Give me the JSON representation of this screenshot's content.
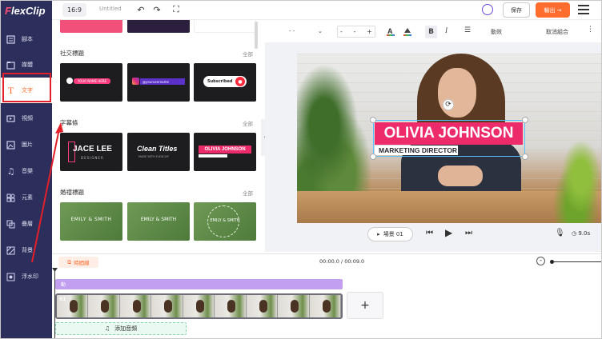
{
  "app": {
    "logo": "FlexClip",
    "ratio": "16:9",
    "project_title": "Untitled",
    "save_label": "保存",
    "export_label": "輸出 →"
  },
  "sidebar": {
    "items": [
      {
        "label": "腳本",
        "icon": "script-icon"
      },
      {
        "label": "媒體",
        "icon": "media-icon"
      },
      {
        "label": "文字",
        "icon": "text-icon",
        "active": true
      },
      {
        "label": "視頻",
        "icon": "video-icon"
      },
      {
        "label": "圖片",
        "icon": "image-icon"
      },
      {
        "label": "音樂",
        "icon": "music-icon"
      },
      {
        "label": "元素",
        "icon": "elements-icon"
      },
      {
        "label": "疊層",
        "icon": "overlay-icon"
      },
      {
        "label": "背景",
        "icon": "background-icon"
      },
      {
        "label": "浮水印",
        "icon": "watermark-icon"
      }
    ]
  },
  "panel": {
    "see_all": "全部",
    "sections": [
      {
        "title": "社交標題",
        "templates": [
          {
            "text": "YOUR NAME HERE",
            "icon": "tiktok-icon"
          },
          {
            "text": "@yourusername",
            "icon": "instagram-icon"
          },
          {
            "text": "Subscribed",
            "icon": "bell-icon"
          }
        ]
      },
      {
        "title": "字幕條",
        "templates": [
          {
            "line1": "JACE LEE",
            "line2": "DESIGNER"
          },
          {
            "line1": "Clean Titles",
            "line2": "MADE WITH FLEXCLIP"
          },
          {
            "line1": "OLIVIA JOHNSON",
            "line2": ""
          }
        ]
      },
      {
        "title": "婚禮標題",
        "templates": [
          {
            "line1": "EMILY & SMITH"
          },
          {
            "line1": "EMILY & SMITH"
          },
          {
            "line1": "EMILY & SMITH"
          }
        ]
      }
    ]
  },
  "toolbar": {
    "font_name": "- -",
    "font_size": "-",
    "bold": "B",
    "italic": "I",
    "animation_label": "動效",
    "ungroup_label": "取消組合"
  },
  "canvas": {
    "title_text": "OLIVIA JOHNSON",
    "subtitle_text": "MARKETING DIRECTOR",
    "colors": {
      "title_bg": "#ed2b6b",
      "accent": "#ff6d2e",
      "sidebar": "#2c2f5b"
    }
  },
  "playback": {
    "scene_label": "場景 01",
    "duration": "9.0s"
  },
  "timeline": {
    "label": "時間線",
    "time": "00:00.0 / 00:09.0",
    "track_label": "動",
    "clip_number": "01",
    "add_audio_label": "添加音頻"
  }
}
